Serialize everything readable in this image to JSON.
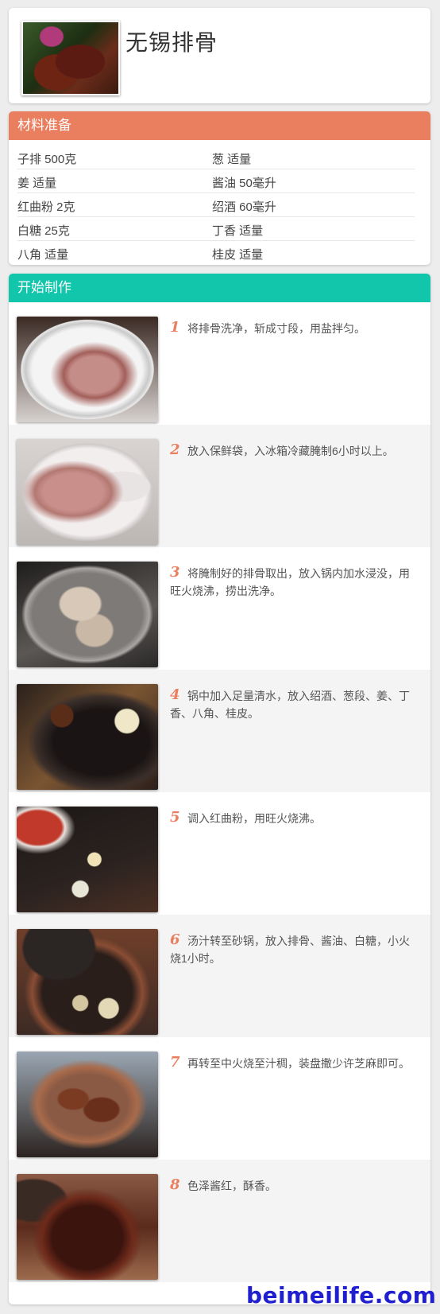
{
  "recipe": {
    "title": "无锡排骨"
  },
  "materials": {
    "header": "材料准备",
    "rows": [
      {
        "left": "子排 500克",
        "right": "葱 适量"
      },
      {
        "left": "姜 适量",
        "right": "酱油 50毫升"
      },
      {
        "left": "红曲粉 2克",
        "right": "绍酒 60毫升"
      },
      {
        "left": "白糖 25克",
        "right": "丁香 适量"
      },
      {
        "left": "八角 适量",
        "right": "桂皮 适量"
      }
    ]
  },
  "steps": {
    "header": "开始制作",
    "items": [
      {
        "num": "1",
        "text": "将排骨洗净，斩成寸段，用盐拌匀。"
      },
      {
        "num": "2",
        "text": "放入保鲜袋，入冰箱冷藏腌制6小时以上。"
      },
      {
        "num": "3",
        "text": "将腌制好的排骨取出，放入锅内加水浸没，用旺火烧沸，捞出洗净。"
      },
      {
        "num": "4",
        "text": "锅中加入足量清水，放入绍酒、葱段、姜、丁香、八角、桂皮。"
      },
      {
        "num": "5",
        "text": "调入红曲粉，用旺火烧沸。"
      },
      {
        "num": "6",
        "text": "汤汁转至砂锅，放入排骨、酱油、白糖，小火烧1小时。"
      },
      {
        "num": "7",
        "text": "再转至中火烧至汁稠，装盘撒少许芝麻即可。"
      },
      {
        "num": "8",
        "text": "色泽酱红，酥香。"
      }
    ]
  },
  "watermark": "beimeilife.com",
  "colors": {
    "materials_header": "#ea7f5f",
    "steps_header": "#12c6ab",
    "step_number": "#ea7f5f",
    "watermark": "#1f1fd0"
  }
}
